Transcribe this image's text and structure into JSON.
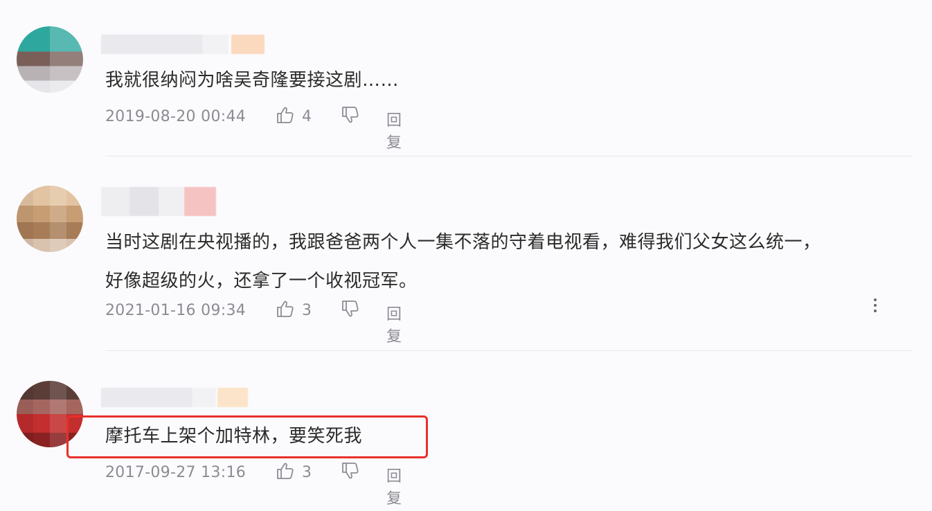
{
  "comments": [
    {
      "text_lines": [
        "我就很纳闷为啥吴奇隆要接这剧……"
      ],
      "date": "2019-08-20 00:44",
      "likes": "4",
      "reply_label": "回复"
    },
    {
      "text_lines": [
        "当时这剧在央视播的，我跟爸爸两个人一集不落的守着电视看，难得我们父女这么统一，",
        "好像超级的火，还拿了一个收视冠军。"
      ],
      "date": "2021-01-16 09:34",
      "likes": "3",
      "reply_label": "回复"
    },
    {
      "text_lines": [
        "摩托车上架个加特林，要笑死我"
      ],
      "date": "2017-09-27 13:16",
      "likes": "3",
      "reply_label": "回复"
    }
  ],
  "more_icon": "more-vertical-icon",
  "colors": {
    "highlight_border": "#e8302b",
    "meta_text": "#8b8b94",
    "body_text": "#2b2b2b"
  }
}
